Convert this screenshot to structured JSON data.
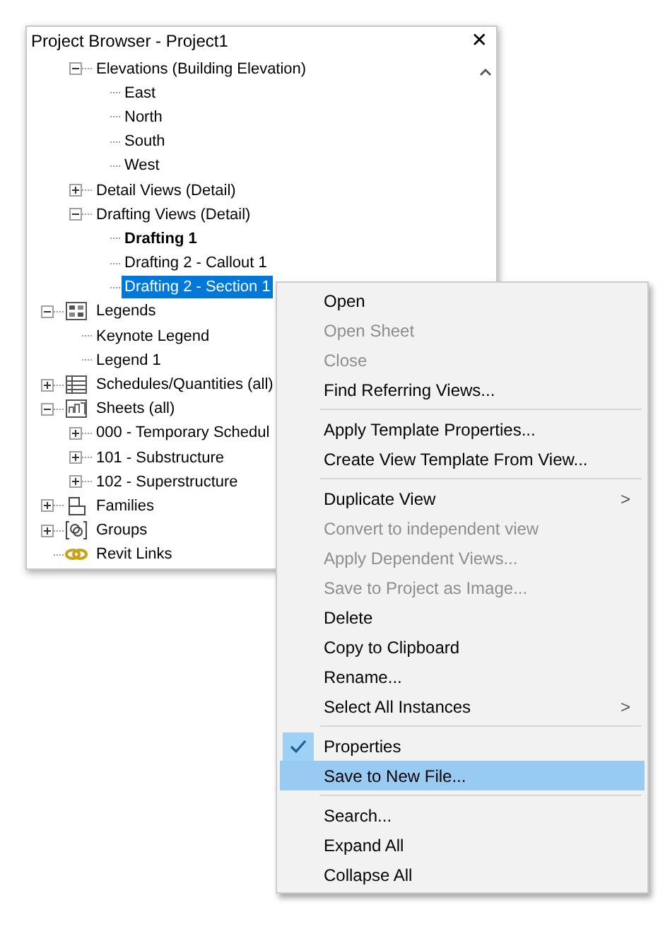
{
  "window": {
    "title": "Project Browser - Project1",
    "close": "✕"
  },
  "tree": {
    "items": [
      {
        "children": [
          {
            "label": "Elevations (Building Elevation)",
            "expanded": true,
            "selected": false,
            "children": [
              {
                "label": "East",
                "selected": false
              },
              {
                "label": "North",
                "selected": false
              },
              {
                "label": "South",
                "selected": false
              },
              {
                "label": "West",
                "selected": false
              }
            ]
          },
          {
            "label": "Detail Views (Detail)",
            "expanded": false,
            "selected": false
          },
          {
            "label": "Drafting Views (Detail)",
            "expanded": true,
            "selected": false,
            "children": [
              {
                "label": "Drafting 1",
                "current": true,
                "selected": false
              },
              {
                "label": "Drafting 2 - Callout 1",
                "selected": false
              },
              {
                "label": "Drafting 2 - Section 1",
                "selected": true
              }
            ]
          }
        ]
      },
      {
        "label": "Legends",
        "kind": "legends",
        "expanded": true,
        "selected": false,
        "children": [
          {
            "label": "Keynote Legend",
            "selected": false
          },
          {
            "label": "Legend 1",
            "selected": false
          }
        ]
      },
      {
        "label": "Schedules/Quantities (all)",
        "kind": "schedules",
        "expanded": false,
        "selected": false
      },
      {
        "label": "Sheets (all)",
        "kind": "sheets",
        "expanded": true,
        "selected": false,
        "children": [
          {
            "label": "000 - Temporary Schedul",
            "expanded": false,
            "selected": false
          },
          {
            "label": "101 - Substructure",
            "expanded": false,
            "selected": false
          },
          {
            "label": "102 - Superstructure",
            "expanded": false,
            "selected": false
          }
        ]
      },
      {
        "label": "Families",
        "kind": "families",
        "expanded": false,
        "selected": false
      },
      {
        "label": "Groups",
        "kind": "groups",
        "expanded": false,
        "selected": false
      },
      {
        "label": "Revit Links",
        "kind": "links",
        "selected": false
      }
    ]
  },
  "context_menu": {
    "groups": [
      [
        {
          "label": "Open",
          "disabled": false,
          "selected": false
        },
        {
          "label": "Open Sheet",
          "disabled": true,
          "selected": false
        },
        {
          "label": "Close",
          "disabled": true,
          "selected": false
        },
        {
          "label": "Find Referring Views...",
          "disabled": false,
          "selected": false
        }
      ],
      [
        {
          "label": "Apply Template Properties...",
          "disabled": false,
          "selected": false
        },
        {
          "label": "Create View Template From View...",
          "disabled": false,
          "selected": false
        }
      ],
      [
        {
          "label": "Duplicate View",
          "disabled": false,
          "selected": false,
          "submenu": ">"
        },
        {
          "label": "Convert to independent view",
          "disabled": true,
          "selected": false
        },
        {
          "label": "Apply Dependent Views...",
          "disabled": true,
          "selected": false
        },
        {
          "label": "Save to Project as Image...",
          "disabled": true,
          "selected": false
        },
        {
          "label": "Delete",
          "disabled": false,
          "selected": false
        },
        {
          "label": "Copy to Clipboard",
          "disabled": false,
          "selected": false
        },
        {
          "label": "Rename...",
          "disabled": false,
          "selected": false
        },
        {
          "label": "Select All Instances",
          "disabled": false,
          "selected": false,
          "submenu": ">"
        }
      ],
      [
        {
          "label": "Properties",
          "disabled": false,
          "selected": false,
          "checked": true
        },
        {
          "label": "Save to New File...",
          "disabled": false,
          "selected": true
        }
      ],
      [
        {
          "label": "Search...",
          "disabled": false,
          "selected": false
        },
        {
          "label": "Expand All",
          "disabled": false,
          "selected": false
        },
        {
          "label": "Collapse All",
          "disabled": false,
          "selected": false
        }
      ]
    ]
  }
}
